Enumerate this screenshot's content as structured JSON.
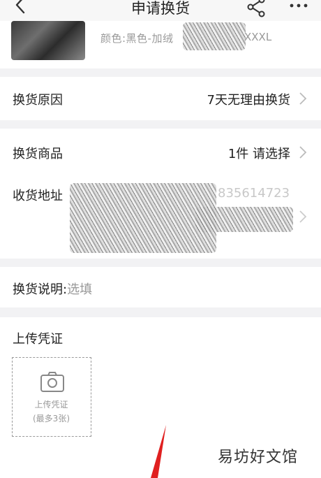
{
  "navbar": {
    "title": "申请换货",
    "back_icon": "chevron-left-icon",
    "share_icon": "share-icon",
    "more_icon": "more-horizontal-icon"
  },
  "product": {
    "spec_text": "颜色:黑色-加绒",
    "spec_size": "XXXL"
  },
  "reason": {
    "label": "换货原因",
    "value": "7天无理由换货"
  },
  "goods": {
    "label": "换货商品",
    "value": "1件 请选择"
  },
  "address": {
    "label": "收货地址",
    "phone_partial": "835614723"
  },
  "note": {
    "label": "换货说明:",
    "placeholder": "选填"
  },
  "upload": {
    "title": "上传凭证",
    "caption_line1": "上传凭证",
    "caption_line2": "(最多3张)"
  },
  "watermark": {
    "text": "易坊好文馆"
  },
  "colors": {
    "page_bg": "#f2f2f4",
    "card_bg": "#ffffff",
    "muted_text": "#999999",
    "accent_mark": "#e02020"
  }
}
